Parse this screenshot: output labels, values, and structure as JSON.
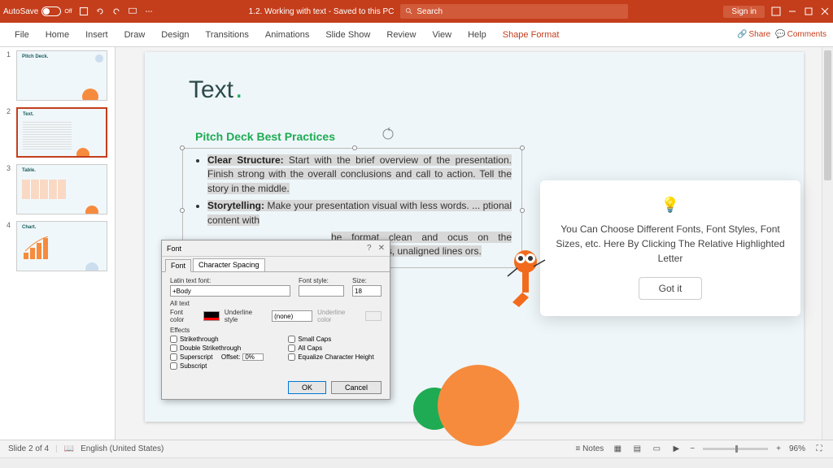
{
  "titlebar": {
    "autosave_label": "AutoSave",
    "autosave_state": "Off",
    "doc_title": "1.2. Working with text - Saved to this PC ",
    "search_placeholder": "Search",
    "signin": "Sign in"
  },
  "menu": {
    "items": [
      "File",
      "Home",
      "Insert",
      "Draw",
      "Design",
      "Transitions",
      "Animations",
      "Slide Show",
      "Review",
      "View",
      "Help",
      "Shape Format"
    ],
    "active_index": 11,
    "share": "Share",
    "comments": "Comments"
  },
  "thumbs": [
    {
      "num": "1",
      "label": "Pitch Deck."
    },
    {
      "num": "2",
      "label": "Text."
    },
    {
      "num": "3",
      "label": "Table."
    },
    {
      "num": "4",
      "label": "Chart."
    }
  ],
  "slide": {
    "title": "Text",
    "subtitle": "Pitch Deck Best Practices",
    "bullets": [
      {
        "b": "Clear Structure:",
        "t": " Start with the brief overview of the presentation. Finish strong with the overall conclusions and call to action. Tell the story in the middle."
      },
      {
        "b": "Storytelling:",
        "t": " Make your presentation visual with less words. ... ptional content with"
      },
      {
        "b_tail": "he format clean and ocus on the message onts, unaligned lines ors."
      }
    ]
  },
  "font_dialog": {
    "title": "Font",
    "tabs": [
      "Font",
      "Character Spacing"
    ],
    "latin_label": "Latin text font:",
    "latin_value": "+Body",
    "style_label": "Font style:",
    "style_value": "",
    "size_label": "Size:",
    "size_value": "18",
    "alltext_label": "All text",
    "fontcolor_label": "Font color",
    "underline_label": "Underline style",
    "underline_value": "(none)",
    "underlinecolor_label": "Underline color",
    "effects_label": "Effects",
    "effects_left": [
      "Strikethrough",
      "Double Strikethrough",
      "Superscript",
      "Subscript"
    ],
    "offset_label": "Offset:",
    "offset_value": "0%",
    "effects_right": [
      "Small Caps",
      "All Caps",
      "Equalize Character Height"
    ],
    "ok": "OK",
    "cancel": "Cancel"
  },
  "tip": {
    "text": "You Can Choose Different Fonts, Font Styles, Font Sizes, etc. Here By Clicking The Relative Highlighted Letter",
    "button": "Got it"
  },
  "statusbar": {
    "slide": "Slide 2 of 4",
    "lang": "English (United States)",
    "notes": "Notes",
    "zoom": "96%"
  }
}
